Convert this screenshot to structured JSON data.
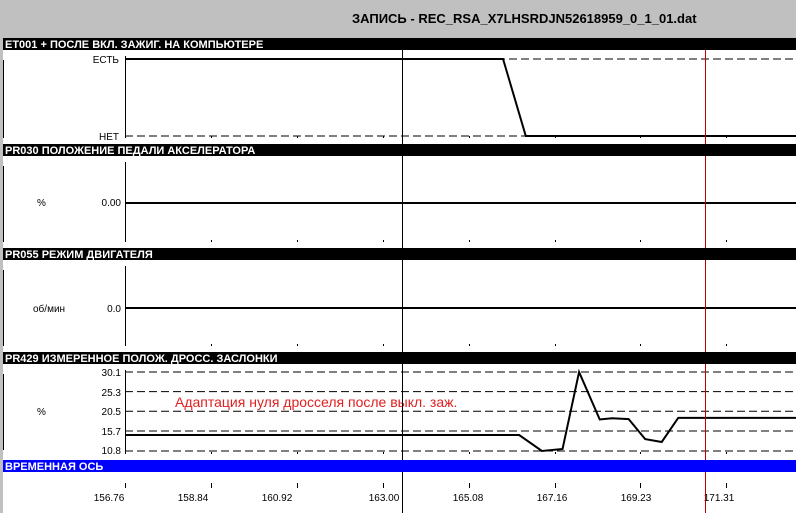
{
  "window": {
    "title": "ЗАПИСЬ - REC_RSA_X7LHSRDJN52618959_0_1_01.dat"
  },
  "panels": [
    {
      "code": "ET001",
      "name": "ET001  + ПОСЛЕ ВКЛ. ЗАЖИГ. НА КОМПЬЮТЕРЕ",
      "unit": "",
      "tick_labels": [
        "ЕСТЬ",
        "НЕТ"
      ]
    },
    {
      "code": "PR030",
      "name": "PR030  ПОЛОЖЕНИЕ ПЕДАЛИ АКСЕЛЕРАТОРА",
      "unit": "%",
      "tick_labels": [
        "0.00"
      ]
    },
    {
      "code": "PR055",
      "name": "PR055  РЕЖИМ ДВИГАТЕЛЯ",
      "unit": "об/мин",
      "tick_labels": [
        "0.0"
      ]
    },
    {
      "code": "PR429",
      "name": "PR429  ИЗМЕРЕННОЕ ПОЛОЖ. ДРОСС. ЗАСЛОНКИ",
      "unit": "%",
      "tick_labels": [
        "30.1",
        "25.3",
        "20.5",
        "15.7",
        "10.8"
      ],
      "annotation": "Адаптация нуля дросселя после выкл. заж."
    }
  ],
  "time_axis": {
    "label": "ВРЕМЕННАЯ ОСЬ",
    "ticks": [
      "156.76",
      "158.84",
      "160.92",
      "163.00",
      "165.08",
      "167.16",
      "169.23",
      "171.31"
    ]
  },
  "colors": {
    "header_bg": "#000000",
    "time_header_bg": "#0000ff",
    "cursor": "#c00000",
    "annotation": "#e02020"
  },
  "chart_data": [
    {
      "type": "line",
      "title": "ET001  + ПОСЛЕ ВКЛ. ЗАЖИГ. НА КОМПЬЮТЕРЕ",
      "categories": [
        "НЕТ",
        "ЕСТЬ"
      ],
      "x": [
        156.76,
        163.0,
        165.91,
        166.46,
        173.0
      ],
      "values": [
        1,
        1,
        1,
        0,
        0
      ],
      "xlim": [
        156.76,
        173.0
      ],
      "grid": true
    },
    {
      "type": "line",
      "title": "PR030  ПОЛОЖЕНИЕ ПЕДАЛИ АКСЕЛЕРАТОРА",
      "ylabel": "%",
      "x": [
        156.76,
        173.0
      ],
      "values": [
        0,
        0
      ],
      "xlim": [
        156.76,
        173.0
      ]
    },
    {
      "type": "line",
      "title": "PR055  РЕЖИМ ДВИГАТЕЛЯ",
      "ylabel": "об/мин",
      "x": [
        156.76,
        173.0
      ],
      "values": [
        0,
        0
      ],
      "xlim": [
        156.76,
        173.0
      ]
    },
    {
      "type": "line",
      "title": "PR429  ИЗМЕРЕННОЕ ПОЛОЖ. ДРОСС. ЗАСЛОНКИ",
      "ylabel": "%",
      "x": [
        156.76,
        166.3,
        166.85,
        167.35,
        167.75,
        168.25,
        168.55,
        168.95,
        169.35,
        169.75,
        170.15,
        173.0
      ],
      "values": [
        14.7,
        14.7,
        10.8,
        11.3,
        30.1,
        18.5,
        18.8,
        18.6,
        13.7,
        13.0,
        18.9,
        18.9
      ],
      "ylim": [
        10.8,
        30.1
      ],
      "xlim": [
        156.76,
        173.0
      ],
      "grid": true
    }
  ]
}
